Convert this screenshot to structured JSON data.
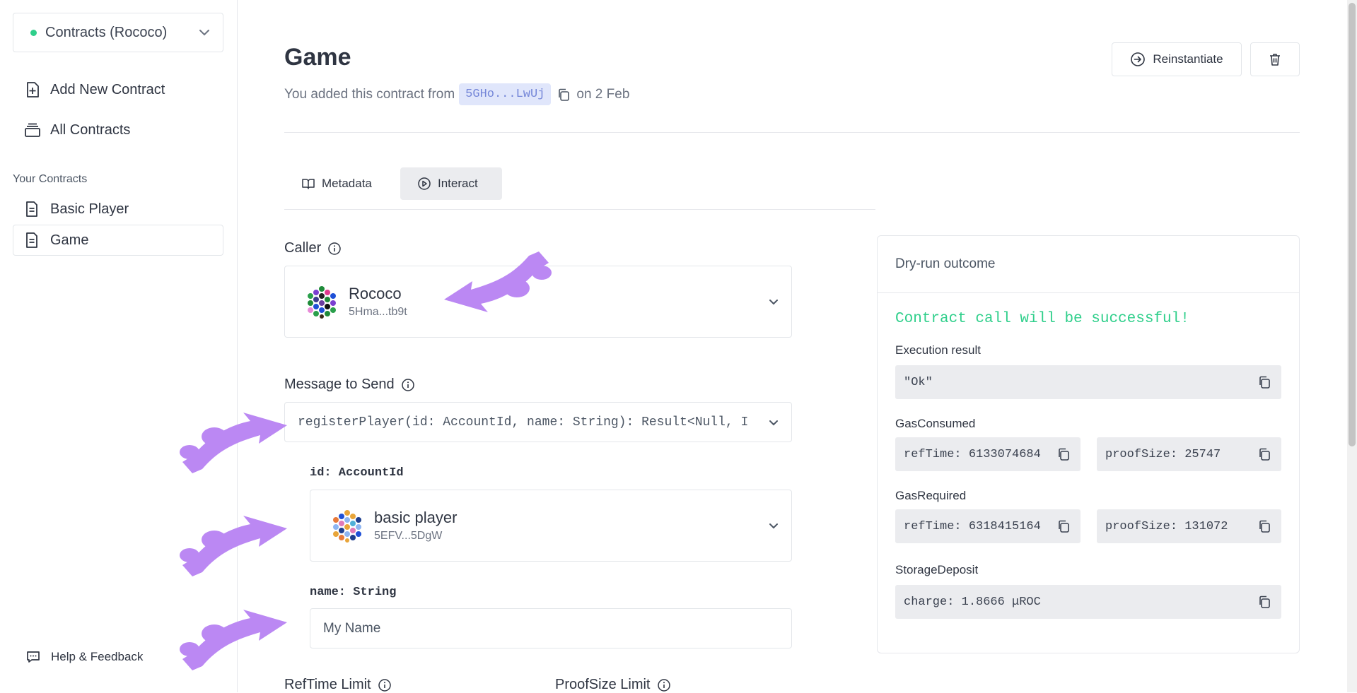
{
  "sidebar": {
    "network_label": "Contracts (Rococo)",
    "add_contract": "Add New Contract",
    "all_contracts": "All Contracts",
    "section_label": "Your Contracts",
    "contracts": [
      "Basic Player",
      "Game"
    ],
    "help": "Help & Feedback"
  },
  "header": {
    "title": "Game",
    "added_prefix": "You added this contract from",
    "address_short": "5GHo...LwUj",
    "added_suffix": "on 2 Feb",
    "reinstantiate": "Reinstantiate"
  },
  "tabs": {
    "metadata": "Metadata",
    "interact": "Interact"
  },
  "caller": {
    "label": "Caller",
    "name": "Rococo",
    "address": "5Hma...tb9t"
  },
  "message": {
    "label": "Message to Send",
    "selected": "registerPlayer(id: AccountId, name: String): Result<Null, I"
  },
  "params": {
    "id_label": "id: AccountId",
    "id_name": "basic player",
    "id_address": "5EFV...5DgW",
    "name_label": "name: String",
    "name_placeholder": "My Name"
  },
  "dry_run": {
    "title": "Dry-run outcome",
    "status": "Contract call will be successful!",
    "execution_label": "Execution result",
    "execution_value": "\"Ok\"",
    "gas_consumed_label": "GasConsumed",
    "gas_consumed_ref": "refTime: 6133074684",
    "gas_consumed_proof": "proofSize: 25747",
    "gas_required_label": "GasRequired",
    "gas_required_ref": "refTime: 6318415164",
    "gas_required_proof": "proofSize: 131072",
    "storage_label": "StorageDeposit",
    "storage_value": "charge: 1.8666 μROC"
  },
  "limits": {
    "reftime_label": "RefTime Limit",
    "proofsize_label": "ProofSize Limit"
  },
  "colors": {
    "accent_green": "#2fcf8b",
    "annotation_arrow": "#bb88f3",
    "address_chip": "#e0e6fb"
  }
}
